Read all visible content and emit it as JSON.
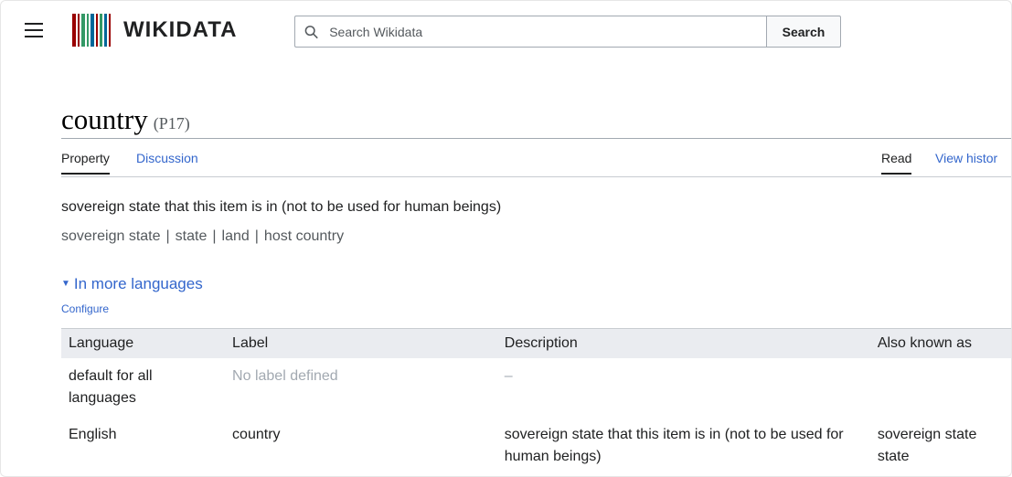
{
  "header": {
    "logo_text": "WIKIDATA",
    "barcode_colors": [
      "#990000",
      "#990000",
      "#339966",
      "#339966",
      "#006699",
      "#990000",
      "#339966",
      "#006699",
      "#990000"
    ],
    "search": {
      "placeholder": "Search Wikidata",
      "value": "",
      "button_label": "Search"
    }
  },
  "page": {
    "title": "country",
    "property_id": "(P17)",
    "tabs_left": [
      "Property",
      "Discussion"
    ],
    "tabs_right": [
      "Read",
      "View histor"
    ],
    "description": "sovereign state that this item is in (not to be used for human beings)",
    "aliases": [
      "sovereign state",
      "state",
      "land",
      "host country"
    ],
    "alias_separator": "|",
    "more_languages_label": "In more languages",
    "configure_label": "Configure"
  },
  "languages_table": {
    "headers": [
      "Language",
      "Label",
      "Description",
      "Also known as"
    ],
    "rows": [
      {
        "language": "default for all languages",
        "label": "No label defined",
        "description": "–",
        "aliases": ""
      },
      {
        "language": "English",
        "label": "country",
        "description": "sovereign state that this item is in (not to be used for human beings)",
        "aliases": "sovereign state state"
      }
    ]
  },
  "colors": {
    "link": "#3366cc",
    "text": "#202122",
    "muted": "#a2a9b1",
    "header_bg": "#eaecf0"
  }
}
